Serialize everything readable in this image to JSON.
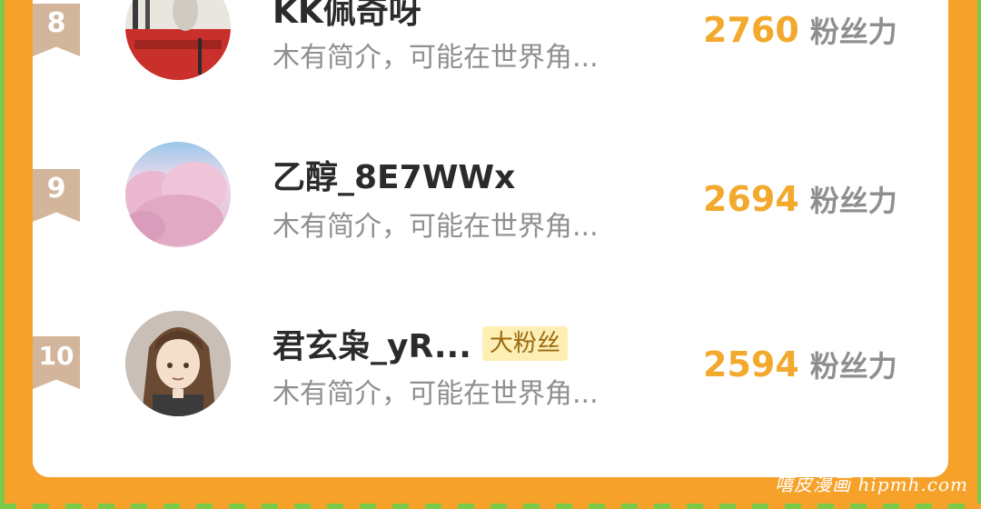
{
  "colors": {
    "background": "#f6a22a",
    "card": "#ffffff",
    "score": "#f2a92d",
    "rank_badge": "#d2b59a",
    "fan_badge_bg": "#fdeeb3"
  },
  "rows": [
    {
      "rank": "8",
      "name": "KK佩奇呀",
      "badge": "",
      "bio": "木有简介，可能在世界角...",
      "score": "2760",
      "unit": "粉丝力",
      "avatar_icon": "cat-avatar"
    },
    {
      "rank": "9",
      "name": "乙醇_8E7WWx",
      "badge": "",
      "bio": "木有简介，可能在世界角...",
      "score": "2694",
      "unit": "粉丝力",
      "avatar_icon": "cherry-blossom-avatar"
    },
    {
      "rank": "10",
      "name": "君玄枭_yR...",
      "badge": "大粉丝",
      "bio": "木有简介，可能在世界角...",
      "score": "2594",
      "unit": "粉丝力",
      "avatar_icon": "anime-character-avatar"
    }
  ],
  "watermark": "嘻皮漫画 hipmh.com"
}
